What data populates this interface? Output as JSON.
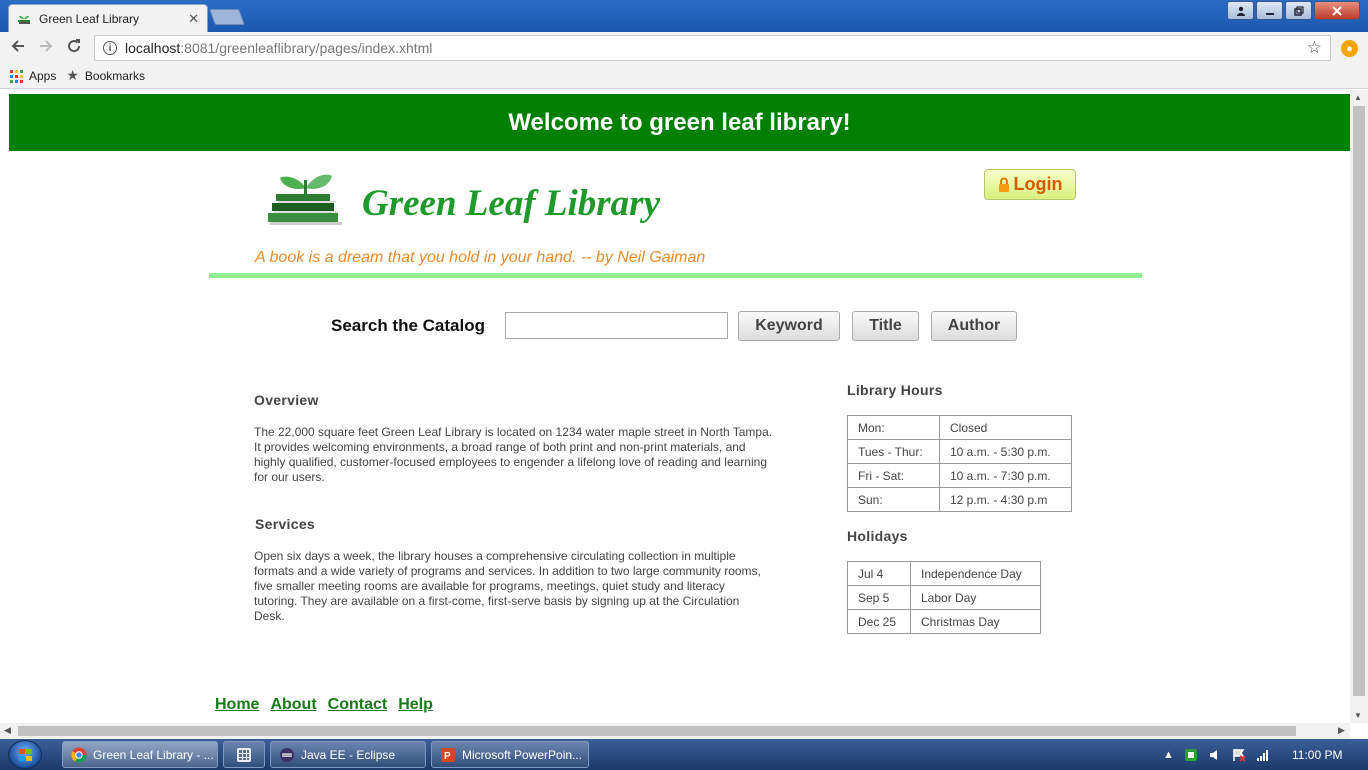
{
  "browser": {
    "tab_title": "Green Leaf Library",
    "url_host": "localhost",
    "url_rest": ":8081/greenleaflibrary/pages/index.xhtml",
    "bookmarks": [
      {
        "label": "Apps",
        "icon": "apps-grid-icon"
      },
      {
        "label": "Bookmarks",
        "icon": "star-icon"
      }
    ]
  },
  "page": {
    "banner": "Welcome to green leaf library!",
    "logo_text": "Green Leaf Library",
    "tagline": "A book is a dream that you hold in your hand. -- by Neil Gaiman",
    "login_label": "Login",
    "search": {
      "label": "Search the Catalog",
      "value": "",
      "buttons": [
        "Keyword",
        "Title",
        "Author"
      ]
    },
    "overview": {
      "heading": "Overview",
      "text": "The 22,000 square feet Green Leaf Library is located on 1234 water maple street in North Tampa. It provides welcoming environments, a broad range of both print and non-print materials, and highly qualified, customer-focused employees to engender a lifelong love of reading and learning for our users."
    },
    "services": {
      "heading": "Services",
      "text": "Open six days a week, the library houses a comprehensive circulating collection in multiple formats and a wide variety of programs and services. In addition to two large community rooms, five smaller meeting rooms are available for programs, meetings, quiet study and literacy tutoring. They are available on a first-come, first-serve basis by signing up at the Circulation Desk."
    },
    "hours": {
      "heading": "Library Hours",
      "rows": [
        [
          "Mon:",
          "Closed"
        ],
        [
          "Tues - Thur:",
          "10 a.m. - 5:30 p.m."
        ],
        [
          "Fri - Sat:",
          "10 a.m. - 7:30 p.m."
        ],
        [
          "Sun:",
          "12 p.m. - 4:30 p.m"
        ]
      ]
    },
    "holidays": {
      "heading": "Holidays",
      "rows": [
        [
          "Jul 4",
          "Independence Day"
        ],
        [
          "Sep 5",
          "Labor Day"
        ],
        [
          "Dec 25",
          "Christmas Day"
        ]
      ]
    },
    "footer_links": [
      "Home",
      "About",
      "Contact",
      "Help"
    ]
  },
  "taskbar": {
    "items": [
      {
        "label": "Green Leaf Library - ...",
        "icon": "chrome-icon",
        "color": "#e44d26"
      },
      {
        "label": "",
        "icon": "calculator-icon",
        "color": "#5a6f8f"
      },
      {
        "label": "Java EE - Eclipse",
        "icon": "eclipse-icon",
        "color": "#3b2f63"
      },
      {
        "label": "Microsoft PowerPoin...",
        "icon": "powerpoint-icon",
        "color": "#d24726"
      }
    ],
    "clock": "11:00 PM"
  },
  "colors": {
    "banner": "#008000",
    "logo": "#1f9a2a",
    "tagline": "#e98b2a",
    "rule": "#90ee90",
    "links": "#1a7a1a"
  }
}
